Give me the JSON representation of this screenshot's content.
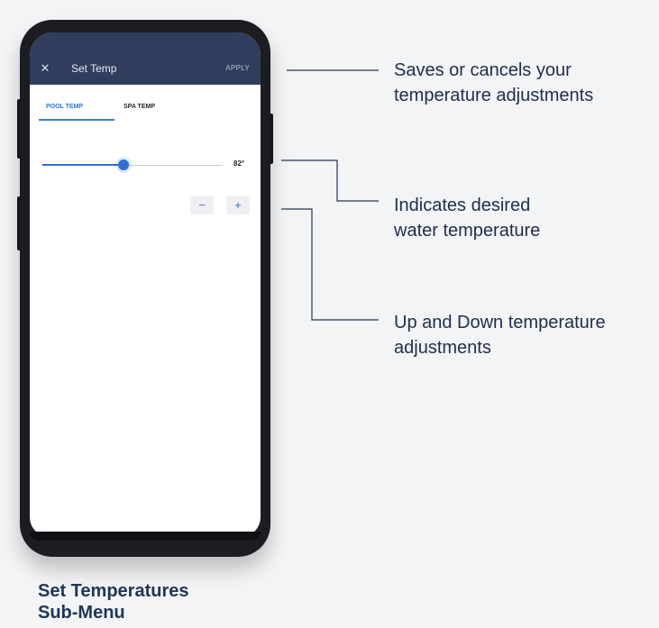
{
  "app": {
    "title": "Set Temp",
    "close_icon": "close-icon",
    "apply_label": "APPLY"
  },
  "tabs": [
    {
      "label": "POOL TEMP",
      "active": true
    },
    {
      "label": "SPA TEMP",
      "active": false
    }
  ],
  "slider": {
    "value_label": "82°",
    "position": 0.45
  },
  "stepper": {
    "minus_symbol": "−",
    "plus_symbol": "+"
  },
  "callouts": [
    {
      "line1": "Saves or cancels your",
      "line2": "temperature adjustments"
    },
    {
      "line1": "Indicates desired",
      "line2": "water temperature"
    },
    {
      "line1": "Up and Down temperature",
      "line2": "adjustments"
    }
  ],
  "caption": {
    "line1": "Set Temperatures",
    "line2": "Sub-Menu"
  },
  "colors": {
    "appbar": "#303d5d",
    "accent": "#2f6fd0",
    "callout_text": "#1f2e4a",
    "background": "#f2f4f6"
  }
}
